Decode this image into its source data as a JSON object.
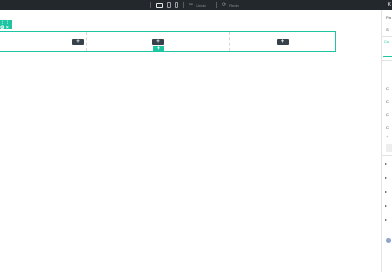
{
  "toolbar": {
    "devices": [
      "desktop-icon",
      "tablet-icon",
      "mobile-icon"
    ],
    "undo_label": "Undo",
    "redo_label": "Redo",
    "right_label": "K"
  },
  "canvas": {
    "section_handle_label": "⋮⋮ ⚙ ×",
    "add_column_label": "+",
    "add_section_label": "+"
  },
  "panel": {
    "items": [
      {
        "label": "Pa"
      },
      {
        "label": "S"
      },
      {
        "label": "Co"
      },
      {
        "label": "C"
      },
      {
        "label": "C"
      },
      {
        "label": "C"
      },
      {
        "label": "C"
      },
      {
        "label": "+"
      }
    ],
    "accordion": [
      "▸",
      "▸",
      "▸",
      "▸",
      "▸",
      "▸"
    ]
  },
  "colors": {
    "accent": "#1dc5a2",
    "toolbar_bg": "#23282d",
    "button_dark": "#37414b"
  }
}
